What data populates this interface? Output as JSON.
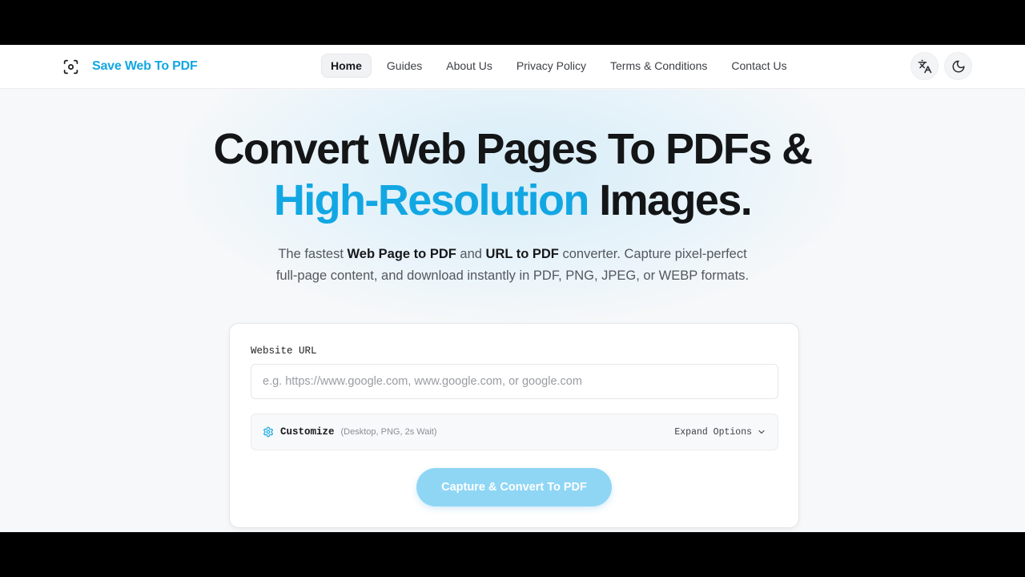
{
  "brand": {
    "name": "Save Web To PDF",
    "icon": "focus-capture-icon",
    "color": "#12a7e3"
  },
  "nav": {
    "items": [
      {
        "label": "Home",
        "active": true
      },
      {
        "label": "Guides"
      },
      {
        "label": "About Us"
      },
      {
        "label": "Privacy Policy"
      },
      {
        "label": "Terms & Conditions"
      },
      {
        "label": "Contact Us"
      }
    ]
  },
  "header_actions": {
    "translate_icon": "translate-icon",
    "theme_icon": "moon-icon"
  },
  "hero": {
    "title_line1": "Convert Web Pages To PDFs &",
    "title_accent": "High-Resolution",
    "title_line2_rest": " Images.",
    "sub_1": "The fastest ",
    "sub_bold_1": "Web Page to PDF",
    "sub_2": " and ",
    "sub_bold_2": "URL to PDF",
    "sub_3": " converter. Capture pixel-perfect",
    "sub_4": "full-page content, and download instantly in PDF, PNG, JPEG, or WEBP formats."
  },
  "form": {
    "url_label": "Website URL",
    "url_value": "",
    "url_placeholder": "e.g. https://www.google.com, www.google.com, or google.com",
    "customize_label": "Customize",
    "customize_summary": "(Desktop, PNG, 2s Wait)",
    "expand_label": "Expand Options",
    "submit_label": "Capture & Convert To PDF"
  },
  "colors": {
    "accent": "#12a7e3",
    "button_disabled": "#8fd6f5"
  }
}
